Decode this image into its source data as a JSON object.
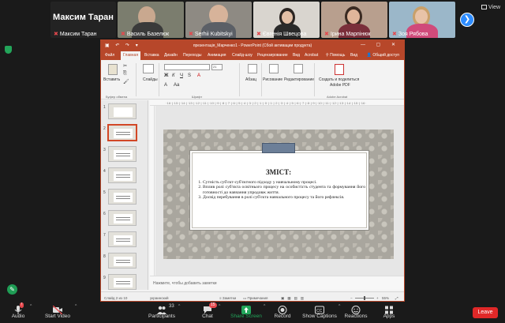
{
  "participants": {
    "active_speaker": "Максим Таран",
    "tiles": [
      {
        "name": "Максим Таран"
      },
      {
        "name": "Василь Базелюк"
      },
      {
        "name": "Serhii Kubitskyi"
      },
      {
        "name": "Євгенія Швецова"
      },
      {
        "name": "Ірина Марпінюк"
      },
      {
        "name": "Зоя Рябова"
      }
    ]
  },
  "view_label": "View",
  "ppt": {
    "title": "презентація_Марченко1 - PowerPoint (Сбой активации продукта)",
    "tabs": [
      "Файл",
      "Главная",
      "Вставка",
      "Дизайн",
      "Переходы",
      "Анимация",
      "Слайд-шоу",
      "Рецензирование",
      "Вид",
      "Acrobat",
      "Помощь",
      "Вид"
    ],
    "active_tab": "Главная",
    "search_label": "Помощь",
    "share_label": "Общий доступ",
    "ribbon": {
      "paste": "Вставить",
      "slides": "Слайды",
      "paragraph": "Абзац",
      "drawing": "Рисование",
      "editing": "Редактирование",
      "acrobat_create": "Создать и поделиться",
      "acrobat_pdf": "Adobe PDF",
      "group_clipboard": "Буфер обмена",
      "group_font": "Шрифт",
      "group_acrobat": "Adobe Acrobat",
      "font_size": "21"
    },
    "ruler_numbers": "·16·|·15·|·14·|·13·|·12·|·11·|·10·|·9·|·8·|·7·|·6·|·5·|·4·|·3·|·2·|·1·|·0·|·1·|·2·|·3·|·4·|·5·|·6·|·7·|·8·|·9·|·10·|·11·|·12·|·13·|·14·|·15·|·16·",
    "slide_numbers": [
      "1",
      "2",
      "3",
      "4",
      "5",
      "6",
      "7",
      "8",
      "9"
    ],
    "slide": {
      "heading": "ЗМІСТ:",
      "items": [
        "Сутність суб'єкт-суб'єктного підходу у навчальному процесі.",
        "Вплив ролі суб'єкта освітнього процесу на особистість студента та формування його готовності до навчання упродовж життя.",
        "Досвід перебування в ролі суб'єкта навчального процесу та його рефлексія."
      ]
    },
    "notes_placeholder": "Нажмите, чтобы добавить заметки",
    "status": {
      "slide_counter": "Слайд 2 из 10",
      "language": "украинский",
      "notes": "Заметки",
      "comments": "Примечания",
      "zoom": "55%"
    }
  },
  "toolbar": {
    "audio": "Audio",
    "video": "Start Video",
    "participants": "Participants",
    "participants_count": "33",
    "chat": "Chat",
    "chat_badge": "15",
    "share": "Share Screen",
    "record": "Record",
    "captions": "Show Captions",
    "reactions": "Reactions",
    "apps": "Apps",
    "leave": "Leave"
  },
  "colors": {
    "ppt_accent": "#b7472a",
    "zoom_green": "#23a55a",
    "leave_red": "#e02828",
    "zoom_blue": "#2d8cff"
  }
}
